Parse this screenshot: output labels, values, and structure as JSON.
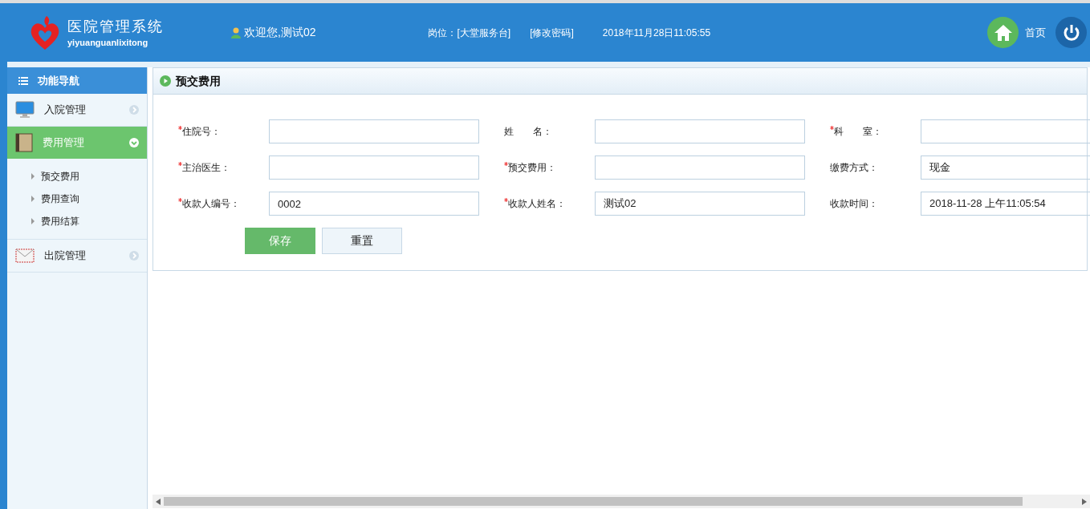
{
  "header": {
    "logo_title": "医院管理系统",
    "logo_subtitle": "yiyuanguanlixitong",
    "welcome": "欢迎您,测试02",
    "position": "岗位：[大堂服务台]",
    "change_password": "[修改密码]",
    "datetime": "2018年11月28日11:05:55",
    "home": "首页"
  },
  "sidebar": {
    "title": "功能导航",
    "items": [
      {
        "label": "入院管理",
        "kind": "monitor",
        "expanded": false
      },
      {
        "label": "费用管理",
        "kind": "book",
        "expanded": true,
        "children": [
          {
            "label": "预交费用"
          },
          {
            "label": "费用查询"
          },
          {
            "label": "费用结算"
          }
        ]
      },
      {
        "label": "出院管理",
        "kind": "envelope",
        "expanded": false
      }
    ]
  },
  "panel": {
    "title": "预交费用",
    "fields": [
      {
        "label": "住院号：",
        "required": true
      },
      {
        "label": "姓　　名：",
        "required": false
      },
      {
        "label": "科　　室：",
        "required": true
      },
      {
        "label": "主治医生：",
        "required": true
      },
      {
        "label": "预交费用：",
        "required": true
      },
      {
        "label": "缴费方式：",
        "required": false,
        "value": "现金"
      },
      {
        "label": "收款人编号：",
        "required": true,
        "value": "0002"
      },
      {
        "label": "收款人姓名：",
        "required": true,
        "value": "测试02"
      },
      {
        "label": "收款时间：",
        "required": false,
        "value": "2018-11-28 上午11:05:54"
      }
    ],
    "buttons": [
      {
        "label": "保存",
        "kind": "primary"
      },
      {
        "label": "重置",
        "kind": "secondary"
      }
    ]
  }
}
